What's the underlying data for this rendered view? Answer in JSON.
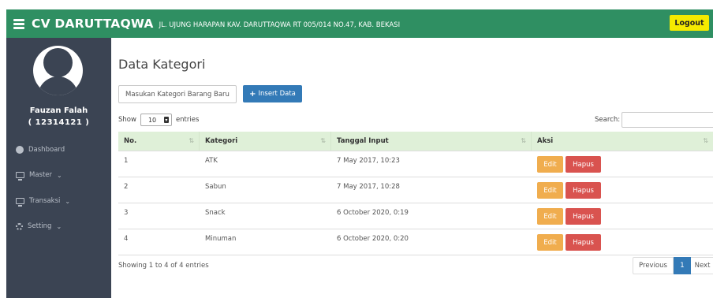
{
  "header": {
    "brand": "CV DARUTTAQWA",
    "address": "JL. UJUNG HARAPAN KAV. DARUTTAQWA RT 005/014 NO.47, KAB. BEKASI",
    "logout_label": "Logout",
    "colors": {
      "bar": "#2f8f62",
      "logout": "#f5ea00"
    }
  },
  "sidebar": {
    "user_name": "Fauzan Falah",
    "user_id": "( 12314121 )",
    "items": [
      {
        "label": "Dashboard",
        "icon": "dashboard-icon"
      },
      {
        "label": "Master",
        "icon": "monitor-icon",
        "chevron": "⌄"
      },
      {
        "label": "Transaksi",
        "icon": "monitor-icon",
        "chevron": "⌄"
      },
      {
        "label": "Setting",
        "icon": "gear-icon",
        "chevron": "⌄"
      }
    ]
  },
  "main": {
    "title": "Data Kategori",
    "input_value": "Masukan Kategori Barang Baru",
    "insert_label": "Insert Data",
    "show_label": "Show",
    "entries_value": "10",
    "entries_label": "entries",
    "search_label": "Search:",
    "table": {
      "headers": [
        "No.",
        "Kategori",
        "Tanggal Input",
        "Aksi"
      ],
      "rows": [
        {
          "no": "1",
          "kategori": "ATK",
          "tanggal": "7 May 2017, 10:23"
        },
        {
          "no": "2",
          "kategori": "Sabun",
          "tanggal": "7 May 2017, 10:28"
        },
        {
          "no": "3",
          "kategori": "Snack",
          "tanggal": "6 October 2020, 0:19"
        },
        {
          "no": "4",
          "kategori": "Minuman",
          "tanggal": "6 October 2020, 0:20"
        }
      ],
      "edit_label": "Edit",
      "hapus_label": "Hapus"
    },
    "showing_text": "Showing 1 to 4 of 4 entries",
    "pagination": {
      "previous": "Previous",
      "current": "1",
      "next": "Next"
    }
  }
}
